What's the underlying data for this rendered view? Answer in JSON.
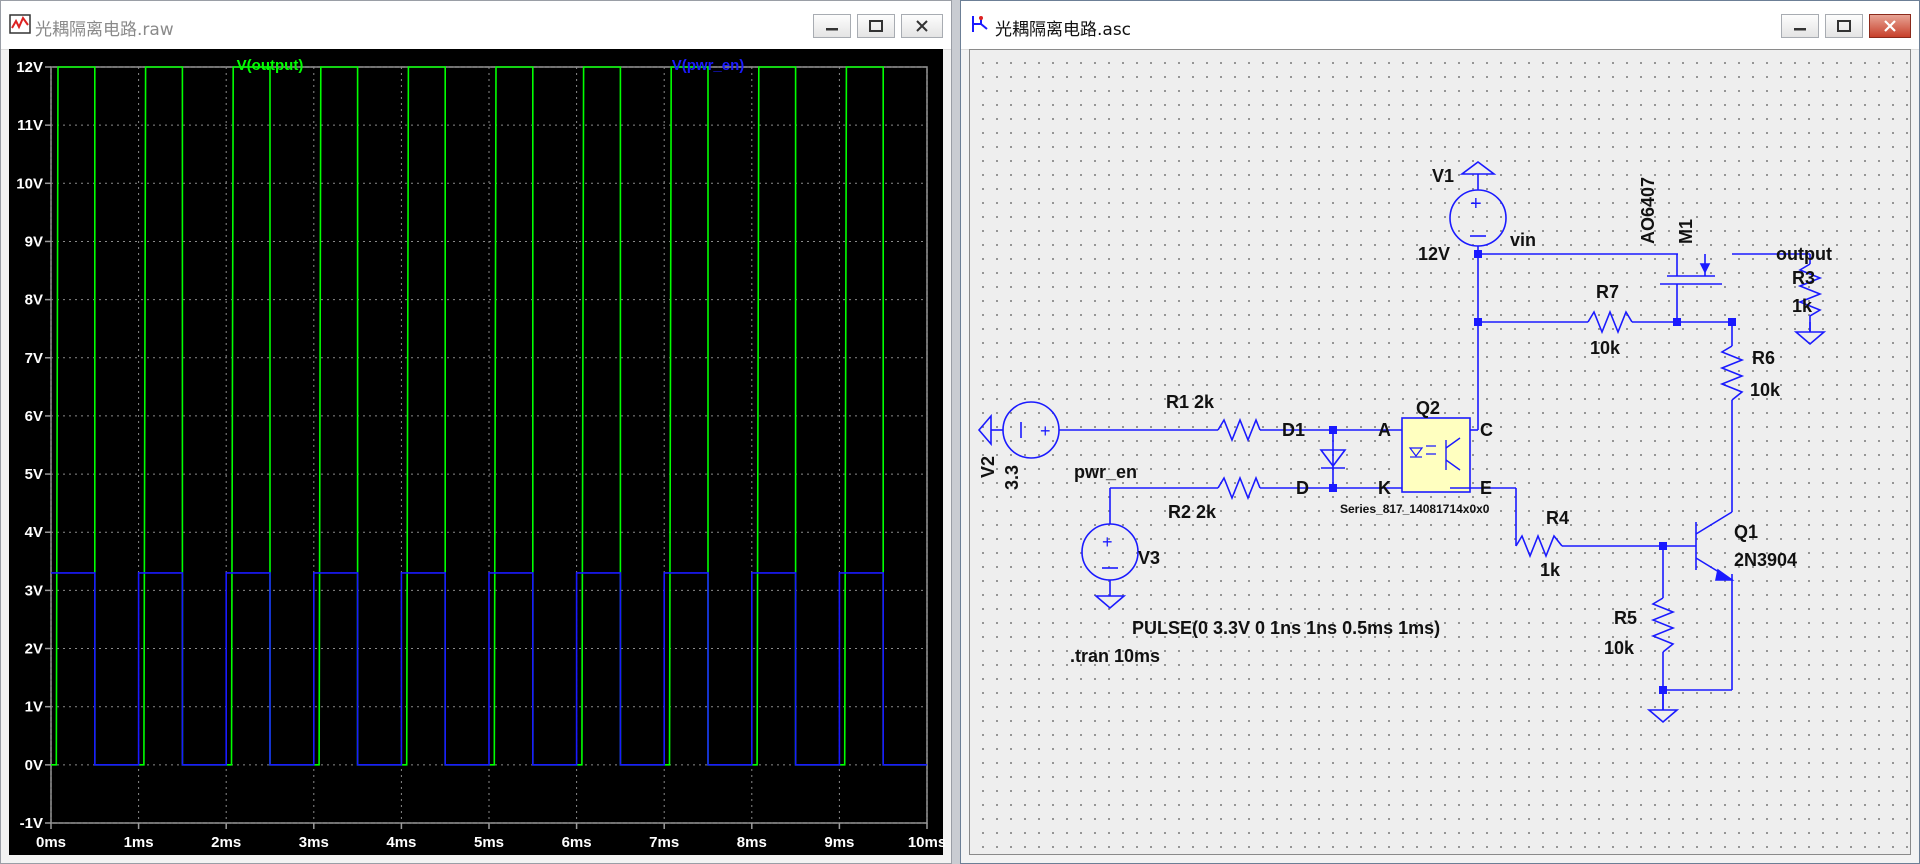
{
  "waveform_window": {
    "title": "光耦隔离电路.raw",
    "icon": "waveform-viewer-icon",
    "buttons": {
      "minimize": "minimize-icon",
      "maximize": "maximize-icon",
      "close": "close-icon"
    }
  },
  "schematic_window": {
    "title": "光耦隔离电路.asc",
    "icon": "schematic-editor-icon",
    "buttons": {
      "minimize": "minimize-icon",
      "maximize": "maximize-icon",
      "close": "close-icon"
    }
  },
  "chart_data": {
    "type": "line",
    "x_unit": "ms",
    "xlim": [
      0,
      10
    ],
    "ylim": [
      -1,
      12
    ],
    "x_ticks": [
      {
        "v": 0,
        "label": "0ms"
      },
      {
        "v": 1,
        "label": "1ms"
      },
      {
        "v": 2,
        "label": "2ms"
      },
      {
        "v": 3,
        "label": "3ms"
      },
      {
        "v": 4,
        "label": "4ms"
      },
      {
        "v": 5,
        "label": "5ms"
      },
      {
        "v": 6,
        "label": "6ms"
      },
      {
        "v": 7,
        "label": "7ms"
      },
      {
        "v": 8,
        "label": "8ms"
      },
      {
        "v": 9,
        "label": "9ms"
      },
      {
        "v": 10,
        "label": "10ms"
      }
    ],
    "y_ticks": [
      {
        "v": 12,
        "label": "12V"
      },
      {
        "v": 11,
        "label": "11V"
      },
      {
        "v": 10,
        "label": "10V"
      },
      {
        "v": 9,
        "label": "9V"
      },
      {
        "v": 8,
        "label": "8V"
      },
      {
        "v": 7,
        "label": "7V"
      },
      {
        "v": 6,
        "label": "6V"
      },
      {
        "v": 5,
        "label": "5V"
      },
      {
        "v": 4,
        "label": "4V"
      },
      {
        "v": 3,
        "label": "3V"
      },
      {
        "v": 2,
        "label": "2V"
      },
      {
        "v": 1,
        "label": "1V"
      },
      {
        "v": 0,
        "label": "0V"
      },
      {
        "v": -1,
        "label": "-1V"
      }
    ],
    "grid": true,
    "background": "#000000",
    "series": [
      {
        "name": "V(output)",
        "color": "#00ff00",
        "points": [
          [
            0,
            0
          ],
          [
            0.06,
            0
          ],
          [
            0.08,
            12
          ],
          [
            0.5,
            12
          ],
          [
            0.5,
            0
          ],
          [
            1.06,
            0
          ],
          [
            1.08,
            12
          ],
          [
            1.5,
            12
          ],
          [
            1.5,
            0
          ],
          [
            2.06,
            0
          ],
          [
            2.08,
            12
          ],
          [
            2.5,
            12
          ],
          [
            2.5,
            0
          ],
          [
            3.06,
            0
          ],
          [
            3.08,
            12
          ],
          [
            3.5,
            12
          ],
          [
            3.5,
            0
          ],
          [
            4.06,
            0
          ],
          [
            4.08,
            12
          ],
          [
            4.5,
            12
          ],
          [
            4.5,
            0
          ],
          [
            5.06,
            0
          ],
          [
            5.08,
            12
          ],
          [
            5.5,
            12
          ],
          [
            5.5,
            0
          ],
          [
            6.06,
            0
          ],
          [
            6.08,
            12
          ],
          [
            6.5,
            12
          ],
          [
            6.5,
            0
          ],
          [
            7.06,
            0
          ],
          [
            7.08,
            12
          ],
          [
            7.5,
            12
          ],
          [
            7.5,
            0
          ],
          [
            8.06,
            0
          ],
          [
            8.08,
            12
          ],
          [
            8.5,
            12
          ],
          [
            8.5,
            0
          ],
          [
            9.06,
            0
          ],
          [
            9.08,
            12
          ],
          [
            9.5,
            12
          ],
          [
            9.5,
            0
          ],
          [
            10,
            0
          ]
        ]
      },
      {
        "name": "V(pwr_en)",
        "color": "#1a1aff",
        "points": [
          [
            0,
            3.3
          ],
          [
            0.5,
            3.3
          ],
          [
            0.5,
            0
          ],
          [
            1,
            0
          ],
          [
            1,
            3.3
          ],
          [
            1.5,
            3.3
          ],
          [
            1.5,
            0
          ],
          [
            2,
            0
          ],
          [
            2,
            3.3
          ],
          [
            2.5,
            3.3
          ],
          [
            2.5,
            0
          ],
          [
            3,
            0
          ],
          [
            3,
            3.3
          ],
          [
            3.5,
            3.3
          ],
          [
            3.5,
            0
          ],
          [
            4,
            0
          ],
          [
            4,
            3.3
          ],
          [
            4.5,
            3.3
          ],
          [
            4.5,
            0
          ],
          [
            5,
            0
          ],
          [
            5,
            3.3
          ],
          [
            5.5,
            3.3
          ],
          [
            5.5,
            0
          ],
          [
            6,
            0
          ],
          [
            6,
            3.3
          ],
          [
            6.5,
            3.3
          ],
          [
            6.5,
            0
          ],
          [
            7,
            0
          ],
          [
            7,
            3.3
          ],
          [
            7.5,
            3.3
          ],
          [
            7.5,
            0
          ],
          [
            8,
            0
          ],
          [
            8,
            3.3
          ],
          [
            8.5,
            3.3
          ],
          [
            8.5,
            0
          ],
          [
            9,
            0
          ],
          [
            9,
            3.3
          ],
          [
            9.5,
            3.3
          ],
          [
            9.5,
            0
          ],
          [
            10,
            0
          ]
        ]
      }
    ]
  },
  "schematic": {
    "colors": {
      "wire": "#1a1aff",
      "junction": "#1a1aff",
      "text": "#111111",
      "component": "#1a1aff",
      "optocoupler_fill": "#ffffc0"
    },
    "labels": {
      "v1_name": "V1",
      "v1_value": "12V",
      "vin": "vin",
      "m1_model": "AO6407",
      "m1_name": "M1",
      "output": "output",
      "r3_name": "R3",
      "r3_value": "1k",
      "r7_name": "R7",
      "r7_value": "10k",
      "r6_name": "R6",
      "r6_value": "10k",
      "q2_name": "Q2",
      "q2_model": "Series_817_14081714x0x0",
      "pin_a": "A",
      "pin_c": "C",
      "pin_k": "K",
      "pin_e": "E",
      "d1_name": "D1",
      "d_label": "D",
      "r1_label": "R1 2k",
      "r2_label": "R2 2k",
      "v2_name": "V2",
      "v2_value": "3.3",
      "pwr_en": "pwr_en",
      "v3_name": "V3",
      "v3_value": "PULSE(0 3.3V 0 1ns 1ns 0.5ms 1ms)",
      "tran": ".tran 10ms",
      "r4_name": "R4",
      "r4_value": "1k",
      "q1_name": "Q1",
      "q1_model": "2N3904",
      "r5_name": "R5",
      "r5_value": "10k"
    }
  }
}
